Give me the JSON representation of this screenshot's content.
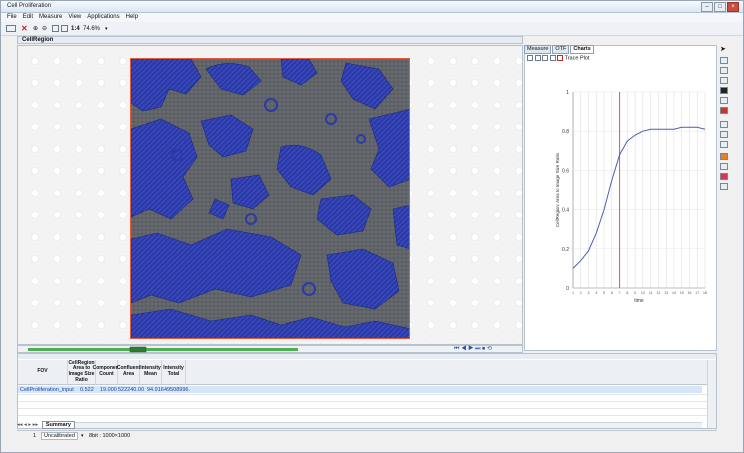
{
  "window": {
    "title": "Cell Proliferation"
  },
  "menu": [
    "File",
    "Edit",
    "Measure",
    "View",
    "Applications",
    "Help"
  ],
  "toolbar": {
    "frame_label": "1:4",
    "zoom": "74.6%"
  },
  "image_panel": {
    "title": "CellRegion"
  },
  "right_tabs": [
    "Measure",
    "OTF",
    "Charts"
  ],
  "chart_toolbar": {
    "label": "Trace Plot"
  },
  "chart_data": {
    "type": "line",
    "title": "",
    "xlabel": "time",
    "ylabel": "CellRegion: Area to Image Size Ratio",
    "ylim": [
      0,
      1
    ],
    "yticks": [
      "0",
      "0.2",
      "0.4",
      "0.6",
      "0.8",
      "1"
    ],
    "xlim": [
      1,
      18
    ],
    "x": [
      1,
      2,
      3,
      4,
      5,
      6,
      7,
      8,
      9,
      10,
      11,
      12,
      13,
      14,
      15,
      16,
      17,
      18
    ],
    "series": [
      {
        "values": [
          0.1,
          0.14,
          0.19,
          0.28,
          0.4,
          0.55,
          0.68,
          0.75,
          0.78,
          0.8,
          0.81,
          0.81,
          0.81,
          0.81,
          0.82,
          0.82,
          0.82,
          0.81
        ]
      }
    ],
    "marker_x": 7,
    "line_color": "#4a5fb0",
    "marker_color": "#e05a3a"
  },
  "table": {
    "columns": [
      "FOV",
      "CellRegion Area to Image Size Ratio",
      "Component Count",
      "Confluent Area",
      "Intensity Mean",
      "Intensity Total"
    ],
    "rows": [
      [
        "CellProliferation_input",
        "0.522",
        "19.000",
        "522240.00",
        "94.916",
        "49508996."
      ]
    ]
  },
  "bottom_tabs": [
    "Summary"
  ],
  "status": {
    "calibration": "Uncalibrated",
    "bitdepth": "8bit : 1000×1000",
    "field_label": "1"
  },
  "colors": {
    "cell_blue": "#2b3aa8",
    "bg_gray": "#6b6b6b",
    "selection_border": "#e35b3a"
  }
}
